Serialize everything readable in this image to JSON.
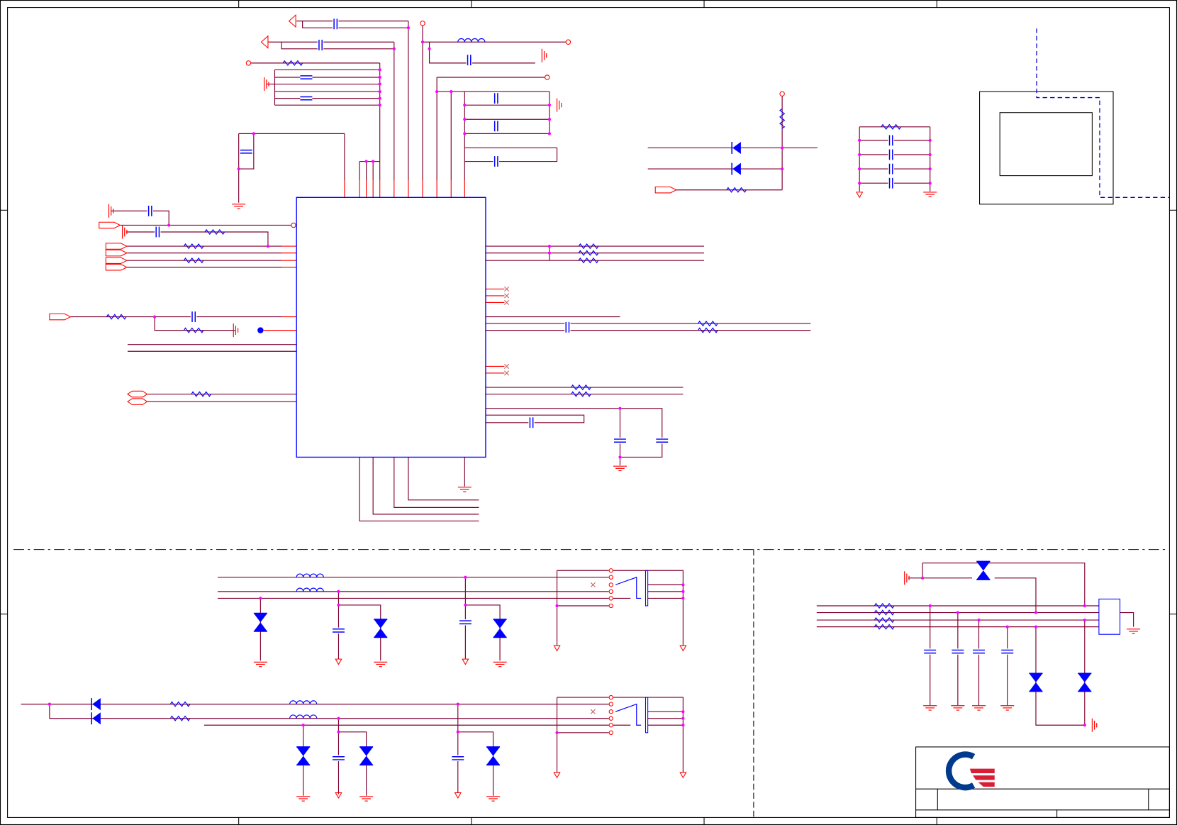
{
  "schematic": {
    "colors": {
      "wire": "#800030",
      "pin": "#ff0000",
      "component": "#0000ff",
      "junction": "#ff00ff",
      "frame": "#000000"
    }
  },
  "title_block": {
    "logo": {
      "icon": "company-logo",
      "colors": [
        "#003a8c",
        "#d81e34"
      ]
    }
  }
}
